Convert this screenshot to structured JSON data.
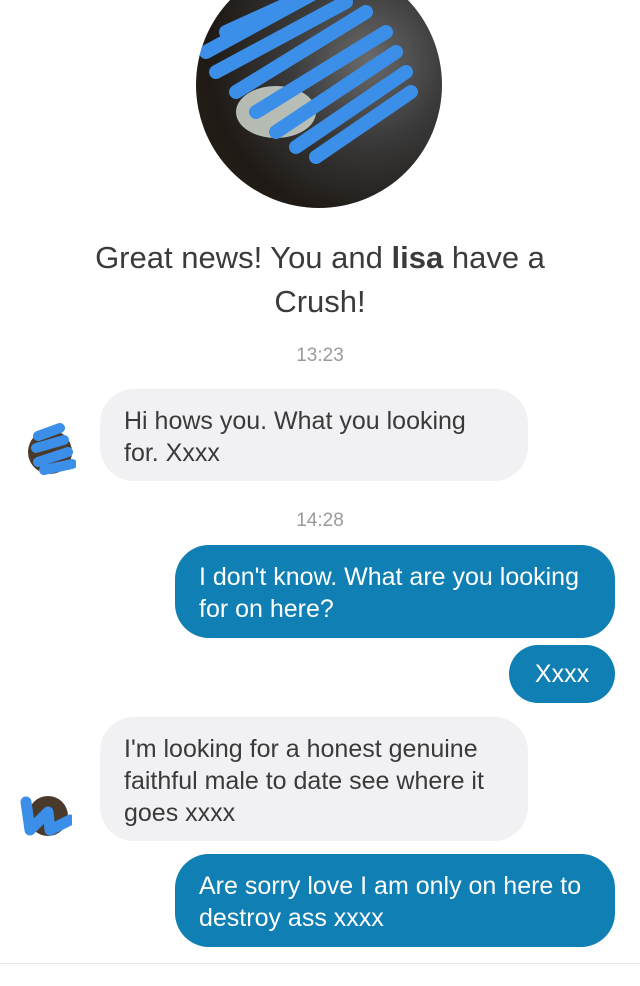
{
  "header": {
    "headline_prefix": "Great news! You and ",
    "match_name": "lisa",
    "headline_suffix": " have a Crush!"
  },
  "messages": [
    {
      "type": "time",
      "text": "13:23"
    },
    {
      "type": "incoming",
      "text": "Hi hows you. What you looking for. Xxxx"
    },
    {
      "type": "time",
      "text": "14:28"
    },
    {
      "type": "outgoing",
      "text": "I don't know. What are you looking for on here?"
    },
    {
      "type": "outgoing",
      "text": "Xxxx"
    },
    {
      "type": "incoming",
      "text": "I'm looking for a honest genuine faithful male to date see where it goes xxxx"
    },
    {
      "type": "outgoing",
      "text": "Are sorry love I am only on here to destroy ass xxxx"
    }
  ],
  "colors": {
    "outgoing_bubble": "#0f7fb4",
    "incoming_bubble": "#f1f1f4",
    "scribble": "#3b8fe8"
  }
}
